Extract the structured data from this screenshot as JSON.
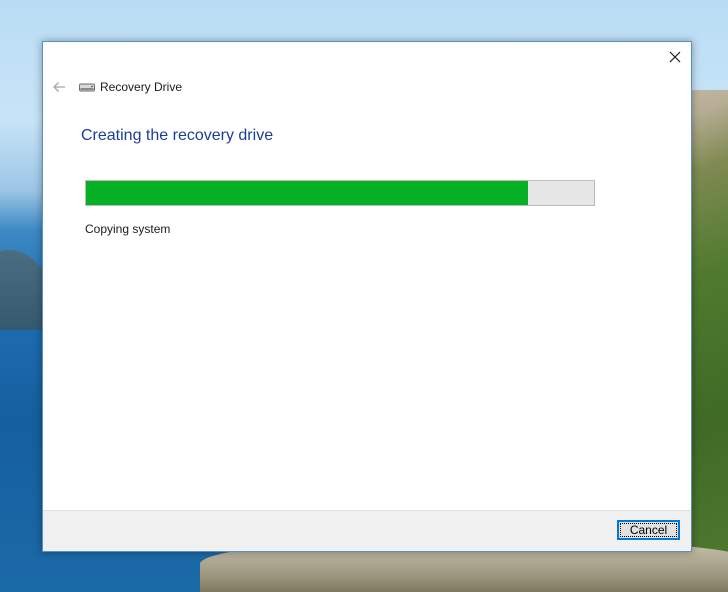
{
  "window": {
    "title": "Recovery Drive",
    "heading": "Creating the recovery drive",
    "status_text": "Copying system",
    "progress_fraction": 0.87
  },
  "icons": {
    "close": "close-icon",
    "back": "back-arrow-icon",
    "app": "drive-icon"
  },
  "footer": {
    "cancel_label": "Cancel"
  },
  "colors": {
    "heading": "#1c3e9a",
    "progress_fill": "#06b025",
    "progress_track": "#e6e6e6",
    "focus_border": "#0078d7"
  }
}
